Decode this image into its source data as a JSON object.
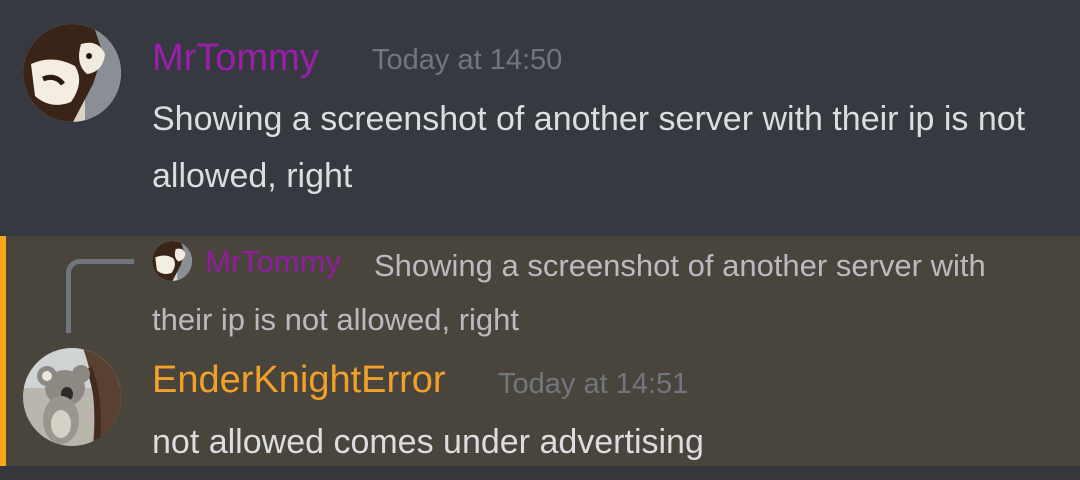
{
  "messages": [
    {
      "username": "MrTommy",
      "username_color": "#9b1ead",
      "timestamp": "Today at 14:50",
      "content": "Showing a screenshot of another server with their ip is not allowed, right",
      "avatar": "cat-avatar"
    },
    {
      "username": "EnderKnightError",
      "username_color": "#f1a02a",
      "timestamp": "Today at 14:51",
      "content": "not allowed comes under advertising",
      "avatar": "koala-avatar",
      "highlighted": true,
      "highlight_color": "#faa81a",
      "reply": {
        "username": "MrTommy",
        "content": "Showing a screenshot of another server with their ip is not allowed, right",
        "avatar": "cat-avatar"
      }
    }
  ]
}
